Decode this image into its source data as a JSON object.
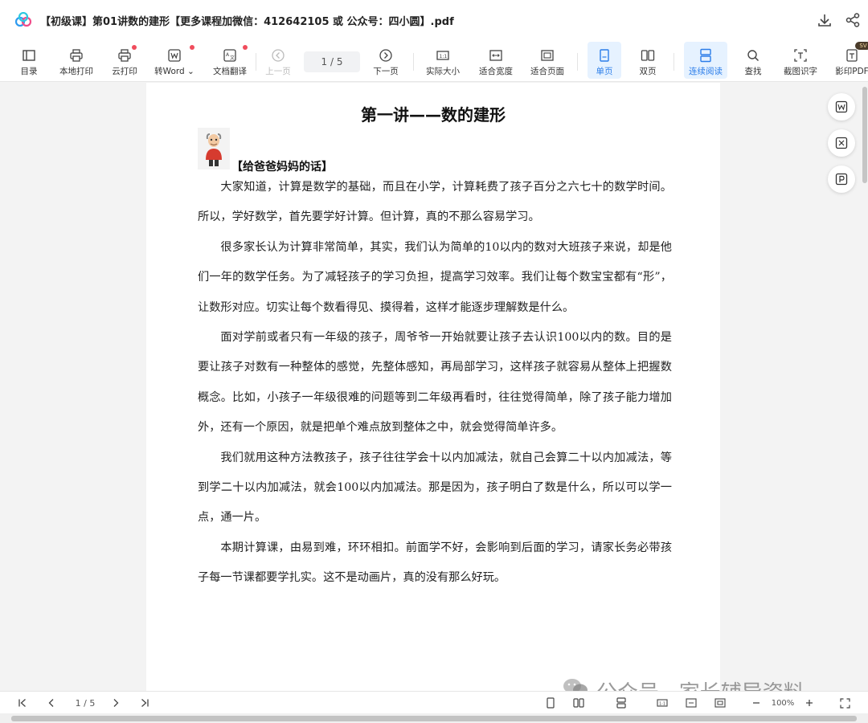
{
  "window": {
    "title": "【初级课】第01讲数的建形【更多课程加微信：412642105 或 公众号：四小圆】.pdf"
  },
  "toolbar": {
    "toc": "目录",
    "local_print": "本地打印",
    "cloud_print": "云打印",
    "to_word": "转Word",
    "translate": "文档翻译",
    "prev_page": "上一页",
    "page_indicator": "1 / 5",
    "next_page": "下一页",
    "actual_size": "实际大小",
    "fit_width": "适合宽度",
    "fit_page": "适合页面",
    "single_page": "单页",
    "two_page": "双页",
    "continuous": "连续阅读",
    "find": "查找",
    "ocr_capture": "截图识字",
    "scan_pdf": "影印PDF",
    "svip_badge": "SVIP"
  },
  "document": {
    "title": "第一讲——数的建形",
    "section_heading": "【给爸爸妈妈的话】",
    "paragraphs": [
      "大家知道，计算是数学的基础，而且在小学，计算耗费了孩子百分之六七十的数学时间。所以，学好数学，首先要学好计算。但计算，真的不那么容易学习。",
      "很多家长认为计算非常简单，其实，我们认为简单的10以内的数对大班孩子来说，却是他们一年的数学任务。为了减轻孩子的学习负担，提高学习效率。我们让每个数宝宝都有“形”，让数形对应。切实让每个数看得见、摸得着，这样才能逐步理解数是什么。",
      "面对学前或者只有一年级的孩子，周爷爷一开始就要让孩子去认识100以内的数。目的是要让孩子对数有一种整体的感觉，先整体感知，再局部学习，这样孩子就容易从整体上把握数概念。比如，小孩子一年级很难的问题等到二年级再看时，往往觉得简单，除了孩子能力增加外，还有一个原因，就是把单个难点放到整体之中，就会觉得简单许多。",
      "我们就用这种方法教孩子，孩子往往学会十以内加减法，就自己会算二十以内加减法，等到学二十以内加减法，就会100以内加减法。那是因为，孩子明白了数是什么，所以可以学一点，通一片。",
      "本期计算课，由易到难，环环相扣。前面学不好，会影响到后面的学习，请家长务必带孩子每一节课都要学扎实。这不是动画片，真的没有那么好玩。"
    ]
  },
  "bottom": {
    "page_indicator": "1 / 5",
    "zoom": "100%"
  },
  "watermark": "公众号 · 家长辅导资料",
  "colors": {
    "accent": "#2b7de9",
    "active_bg": "#e6f2ff",
    "notify_dot": "#f04c5c"
  }
}
